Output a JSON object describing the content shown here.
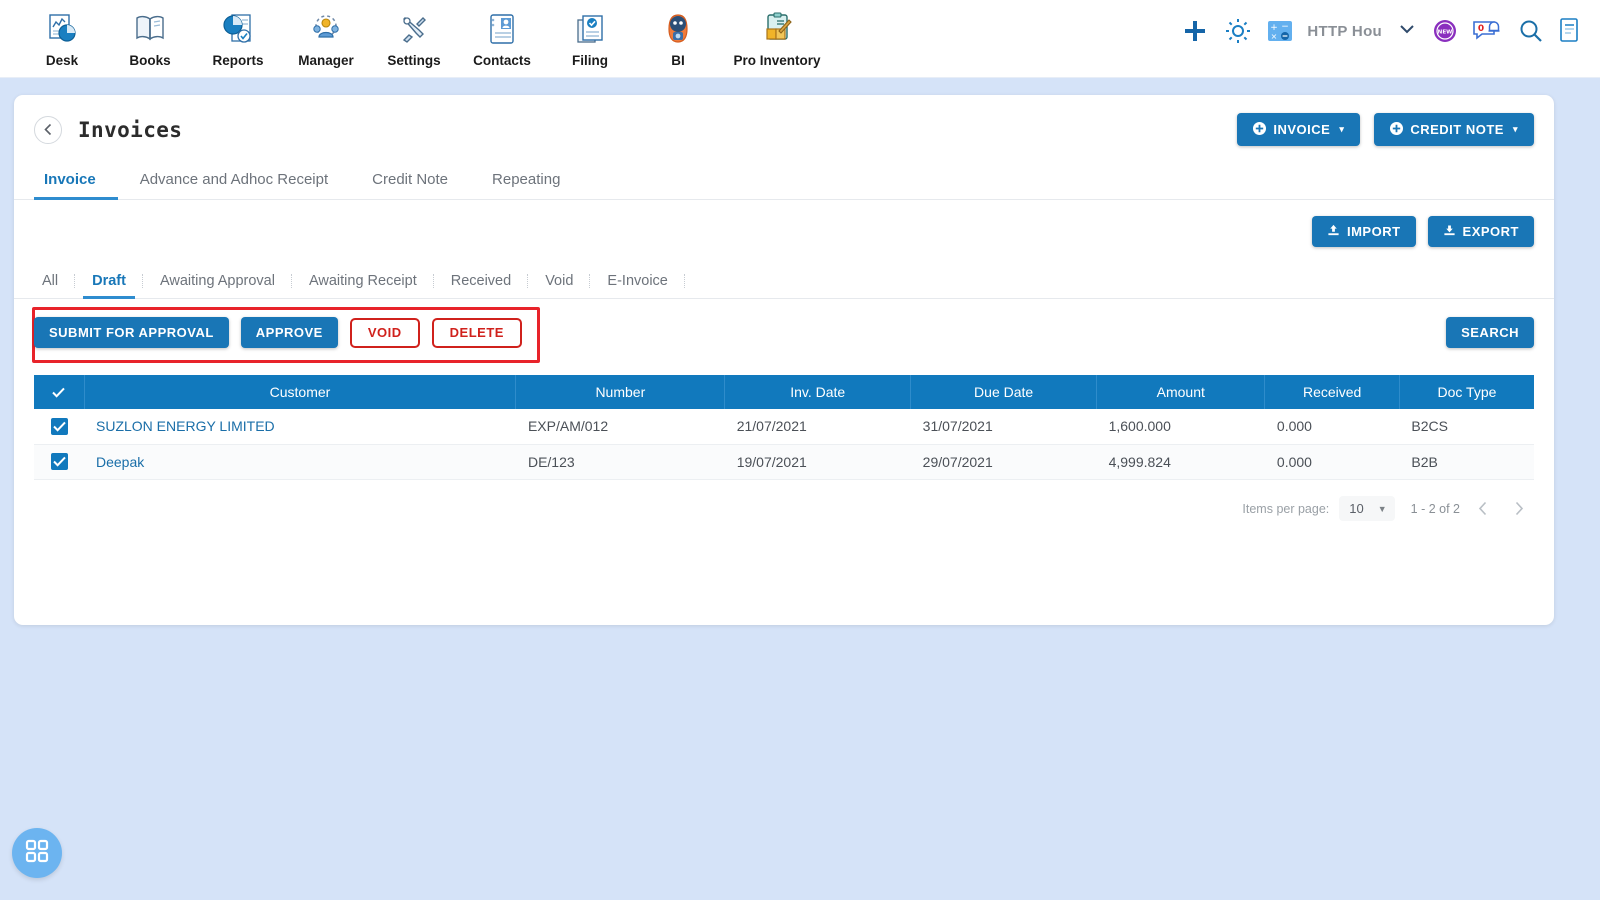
{
  "topnav": {
    "modules": [
      {
        "label": "Desk",
        "icon": "desk-chart-icon"
      },
      {
        "label": "Books",
        "icon": "books-icon"
      },
      {
        "label": "Reports",
        "icon": "reports-piechart-icon"
      },
      {
        "label": "Manager",
        "icon": "manager-people-icon"
      },
      {
        "label": "Settings",
        "icon": "settings-tools-icon"
      },
      {
        "label": "Contacts",
        "icon": "contacts-card-icon"
      },
      {
        "label": "Filing",
        "icon": "filing-documents-icon"
      },
      {
        "label": "BI",
        "icon": "bi-robot-icon"
      },
      {
        "label": "Pro Inventory",
        "icon": "pro-inventory-clipboard-icon"
      }
    ],
    "right": {
      "add_icon": "plus-icon",
      "settings_icon": "gear-icon",
      "calculator_icon": "calculator-icon",
      "org_name": "HTTP Hou",
      "chevron_icon": "chevron-down-icon",
      "new_badge_label": "NEW",
      "chat_icon": "chat-bell-icon",
      "chat_count": "0",
      "search_icon": "search-icon",
      "notes_icon": "notes-document-icon"
    }
  },
  "page": {
    "back_icon": "chevron-left-icon",
    "title": "Invoices",
    "actions": [
      {
        "label": "INVOICE",
        "icon": "plus-circle-icon",
        "caret": "▾"
      },
      {
        "label": "CREDIT NOTE",
        "icon": "plus-circle-icon",
        "caret": "▾"
      }
    ]
  },
  "tabs": [
    {
      "label": "Invoice",
      "active": true
    },
    {
      "label": "Advance and Adhoc Receipt",
      "active": false
    },
    {
      "label": "Credit Note",
      "active": false
    },
    {
      "label": "Repeating",
      "active": false
    }
  ],
  "io_buttons": [
    {
      "label": "IMPORT",
      "icon": "import-upload-icon"
    },
    {
      "label": "EXPORT",
      "icon": "export-download-icon"
    }
  ],
  "filters": [
    {
      "label": "All",
      "active": false
    },
    {
      "label": "Draft",
      "active": true
    },
    {
      "label": "Awaiting Approval",
      "active": false
    },
    {
      "label": "Awaiting Receipt",
      "active": false
    },
    {
      "label": "Received",
      "active": false
    },
    {
      "label": "Void",
      "active": false
    },
    {
      "label": "E-Invoice",
      "active": false
    }
  ],
  "actionbar": {
    "submit_label": "SUBMIT FOR APPROVAL",
    "approve_label": "APPROVE",
    "void_label": "VOID",
    "delete_label": "DELETE",
    "search_label": "SEARCH",
    "highlight_color": "#e8232a"
  },
  "table": {
    "columns": [
      "Customer",
      "Number",
      "Inv. Date",
      "Due Date",
      "Amount",
      "Received",
      "Doc Type"
    ],
    "header_checkbox_checked": true,
    "rows": [
      {
        "checked": true,
        "customer": "SUZLON ENERGY LIMITED",
        "number": "EXP/AM/012",
        "inv_date": "21/07/2021",
        "due_date": "31/07/2021",
        "amount": "1,600.000",
        "received": "0.000",
        "doc_type": "B2CS"
      },
      {
        "checked": true,
        "customer": "Deepak",
        "number": "DE/123",
        "inv_date": "19/07/2021",
        "due_date": "29/07/2021",
        "amount": "4,999.824",
        "received": "0.000",
        "doc_type": "B2B"
      }
    ]
  },
  "paginator": {
    "items_per_page_label": "Items per page:",
    "items_per_page_value": "10",
    "range_label": "1 - 2 of 2",
    "prev_icon": "chevron-left-icon",
    "next_icon": "chevron-right-icon"
  },
  "fab": {
    "icon": "grid-apps-icon"
  },
  "colors": {
    "background": "#d5e3f8",
    "primary": "#1976b6",
    "table_header": "#1179bd",
    "danger": "#d0211c",
    "link": "#1a6ea8"
  }
}
